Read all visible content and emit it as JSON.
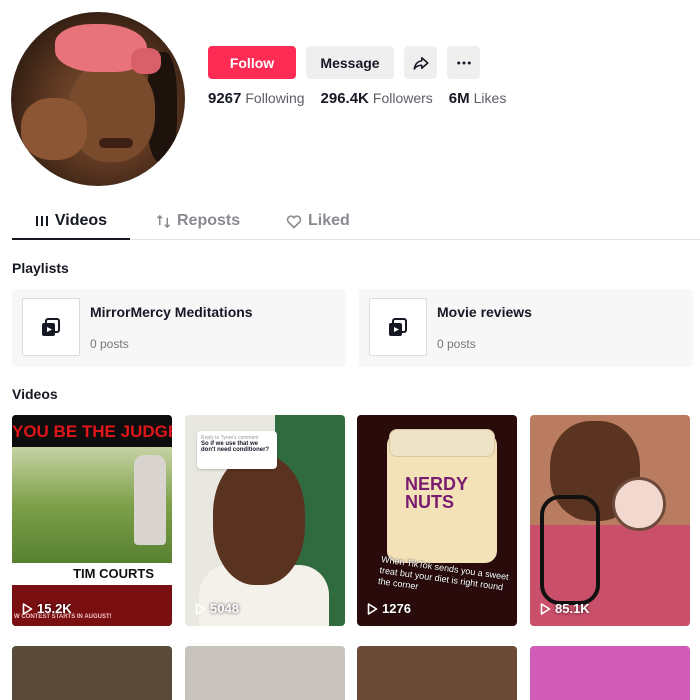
{
  "profile": {
    "follow_label": "Follow",
    "message_label": "Message",
    "stats": {
      "following_count": "9267",
      "following_label": "Following",
      "followers_count": "296.4K",
      "followers_label": "Followers",
      "likes_count": "6M",
      "likes_label": "Likes"
    }
  },
  "tabs": [
    {
      "label": "Videos",
      "icon": "grid-icon",
      "active": true
    },
    {
      "label": "Reposts",
      "icon": "repost-icon",
      "active": false
    },
    {
      "label": "Liked",
      "icon": "heart-icon",
      "active": false
    }
  ],
  "playlists": {
    "title": "Playlists",
    "items": [
      {
        "name": "MirrorMercy Meditations",
        "count": "0 posts"
      },
      {
        "name": "Movie reviews",
        "count": "0 posts"
      }
    ]
  },
  "videos": {
    "title": "Videos",
    "items": [
      {
        "views": "15.2K",
        "banner": "YOU BE THE JUDGE",
        "name_text": "TIM COURTS",
        "footer": "W CONTEST STARTS IN AUGUST!"
      },
      {
        "views": "5048",
        "reply_header": "Reply to Tyree's comment",
        "reply_text": "So if we use that we don't need conditioner?"
      },
      {
        "views": "1276",
        "jar_label": "NERDY NUTS",
        "caption": "When TikTok sends you a sweet treat but your diet is right round the corner"
      },
      {
        "views": "85.1K"
      }
    ]
  },
  "colors": {
    "accent": "#fe2c55",
    "text": "#161823",
    "muted": "#8a8b91"
  }
}
